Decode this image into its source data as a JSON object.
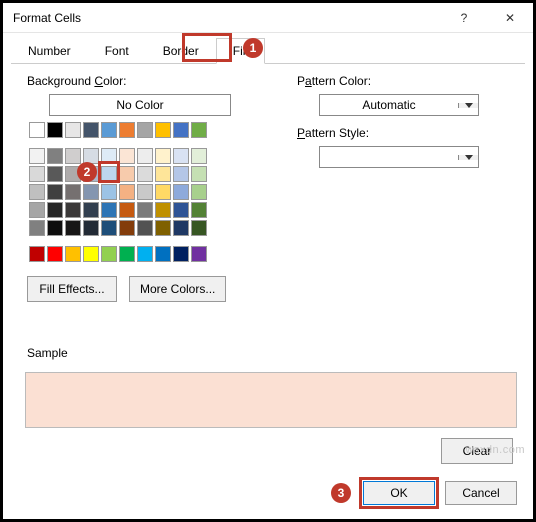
{
  "title": "Format Cells",
  "titlebar": {
    "help": "?",
    "close": "✕"
  },
  "tabs": [
    "Number",
    "Font",
    "Border",
    "Fill"
  ],
  "active_tab": 3,
  "bg_label": "Background Color:",
  "no_color": "No Color",
  "pattern_color_label": "Pattern Color:",
  "pattern_color_value": "Automatic",
  "pattern_style_label": "Pattern Style:",
  "pattern_style_value": "",
  "fill_effects": "Fill Effects...",
  "more_colors": "More Colors...",
  "sample_label": "Sample",
  "sample_color": "#fbe0d3",
  "clear": "Clear",
  "ok": "OK",
  "cancel": "Cancel",
  "watermark": "wsxdn.com",
  "badges": {
    "b1": "1",
    "b2": "2",
    "b3": "3"
  },
  "palette": {
    "row0": [
      "#ffffff",
      "#000000",
      "#e7e6e6",
      "#44546a",
      "#5b9bd5",
      "#ed7d31",
      "#a5a5a5",
      "#ffc000",
      "#4472c4",
      "#70ad47"
    ],
    "rows": [
      [
        "#f2f2f2",
        "#808080",
        "#d0cece",
        "#d6dce4",
        "#deebf6",
        "#fbe5d5",
        "#ededed",
        "#fff2cc",
        "#d9e2f3",
        "#e2efd9"
      ],
      [
        "#d9d9d9",
        "#595959",
        "#aeabab",
        "#adb9ca",
        "#bdd7ee",
        "#f7cbac",
        "#dbdbdb",
        "#fee599",
        "#b4c6e7",
        "#c5e0b3"
      ],
      [
        "#bfbfbf",
        "#404040",
        "#757070",
        "#8496b0",
        "#9cc3e5",
        "#f4b183",
        "#c9c9c9",
        "#ffd965",
        "#8eaadb",
        "#a8d08d"
      ],
      [
        "#a6a6a6",
        "#262626",
        "#3a3838",
        "#323f4f",
        "#2e75b5",
        "#c55a11",
        "#7b7b7b",
        "#bf9000",
        "#2f5496",
        "#538135"
      ],
      [
        "#808080",
        "#0d0d0d",
        "#171616",
        "#222a35",
        "#1e4e79",
        "#833c0b",
        "#525252",
        "#7f6000",
        "#1f3864",
        "#375623"
      ]
    ],
    "standard": [
      "#c00000",
      "#ff0000",
      "#ffc000",
      "#ffff00",
      "#92d050",
      "#00b050",
      "#00b0f0",
      "#0070c0",
      "#002060",
      "#7030a0"
    ]
  },
  "selected": {
    "row": 1,
    "col": 4
  }
}
